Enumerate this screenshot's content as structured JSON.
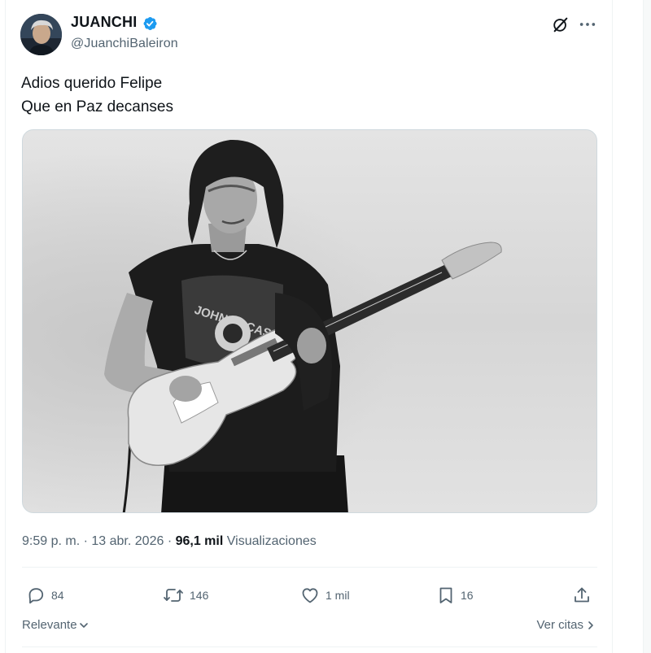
{
  "author": {
    "name": "JUANCHI",
    "handle": "@JuanchiBaleiron",
    "verified": true
  },
  "tweet": {
    "lines": [
      "Adios querido Felipe",
      "Que en Paz decanses"
    ],
    "time": "9:59 p. m.",
    "separator": "·",
    "date": "13 abr. 2026",
    "views_count": "96,1 mil",
    "views_label": "Visualizaciones"
  },
  "actions": {
    "replies": "84",
    "reposts": "146",
    "likes": "1 mil",
    "bookmarks": "16"
  },
  "footer": {
    "sort_label": "Relevante",
    "quotes_label": "Ver citas"
  },
  "colors": {
    "verified": "#1d9bf0",
    "text": "#0f1419",
    "secondary": "#536471",
    "border": "#eff3f4"
  },
  "icons": {
    "header": [
      "grok-icon",
      "more-icon"
    ],
    "actions": [
      "reply-icon",
      "repost-icon",
      "like-icon",
      "bookmark-icon",
      "share-icon"
    ]
  }
}
